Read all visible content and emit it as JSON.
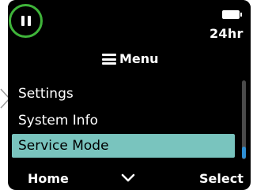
{
  "status_bar": {
    "pause_icon": "pause-icon",
    "battery_icon": "battery-full-icon",
    "clock_mode": "24hr",
    "accent_color": "#3fb43a"
  },
  "title": {
    "icon": "menu-icon",
    "label": "Menu"
  },
  "menu": {
    "items": [
      {
        "label": "Settings",
        "selected": false
      },
      {
        "label": "System Info",
        "selected": false
      },
      {
        "label": "Service Mode",
        "selected": true
      }
    ],
    "highlight_color": "#79c4be",
    "scroll_position": 1.0
  },
  "softkeys": {
    "left": "Home",
    "center_icon": "chevron-down-icon",
    "right": "Select"
  }
}
